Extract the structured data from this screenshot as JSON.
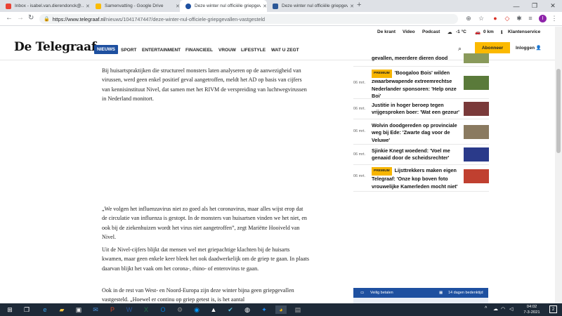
{
  "browser": {
    "tabs": [
      {
        "title": "Inbox - isabel.van.dierendonck@...",
        "icon": "gmail-icon",
        "color": "#ea4335"
      },
      {
        "title": "Samenvatting - Google Drive",
        "icon": "drive-icon",
        "color": "#fbbc04"
      },
      {
        "title": "Deze winter nul officiële griepgev...",
        "icon": "telegraaf-icon",
        "color": "#1e50a0"
      },
      {
        "title": "Deze winter nul officiële griepgev...",
        "icon": "dl-icon",
        "color": "#2b5797"
      }
    ],
    "url_host": "https://www.telegraaf.nl",
    "url_path": "/nieuws/1041747447/deze-winter-nul-officiele-griepgevallen-vastgesteld",
    "profile_initial": "I"
  },
  "site": {
    "logo": "De Telegraaf",
    "topbar": {
      "krant": "De krant",
      "video": "Video",
      "podcast": "Podcast",
      "temp": "-1 °C",
      "traffic": "0 km",
      "service": "Klantenservice"
    },
    "nav": [
      "NIEUWS",
      "SPORT",
      "ENTERTAINMENT",
      "FINANCIEEL",
      "VROUW",
      "LIFESTYLE",
      "WAT U ZEGT"
    ],
    "abonneer": "Abonneer",
    "login": "Inloggen"
  },
  "article": {
    "p1": "Bij huisartspraktijken die structureel monsters laten analyseren op de aanwezigheid van virussen, werd geen enkel positief geval aangetroffen, meldt het AD op basis van cijfers van kennisinstituut Nivel, dat samen met het RIVM de verspreiding van luchtwegvirussen in Nederland monitort.",
    "p2": "„We volgen het influenzavirus niet zo goed als het coronavirus, maar alles wijst erop dat de circulatie van influenza is gestopt. In de monsters van huisartsen vinden we het niet, en ook bij de ziekenhuizen wordt het virus niet aangetroffen”, zegt Mariëtte Hooiveld van Nivel.",
    "p3": "Uit de Nivel-cijfers blijkt dat mensen wel met griepachtige klachten bij de huisarts kwamen, maar geen enkele keer bleek het ook daadwerkelijk om de griep te gaan. In plaats daarvan blijkt het vaak om het corona-, rhino- of enterovirus te gaan.",
    "p4": "Ook in de rest van West- en Noord-Europa zijn deze winter bijna geen griepgevallen vastgesteld. „Hoewel er continu op griep getest is, is het aantal"
  },
  "sidebar": {
    "premium_label": "PREMIUM",
    "items": [
      {
        "date": "",
        "title": "gevallen, meerdere dieren dood",
        "premium": false,
        "thumb": "#8a9a5b"
      },
      {
        "date": "06 mrt.",
        "title": "'Boogaloo Bois' wilden zwaarbewapende extreemrechtse Nederlander sponsoren: 'Help onze Boi'",
        "premium": true,
        "thumb": "#5a7a3a"
      },
      {
        "date": "06 mrt.",
        "title": "Justitie in hoger beroep tegen vrijgesproken boer: 'Wat een gezeur'",
        "premium": false,
        "thumb": "#7a3a3a"
      },
      {
        "date": "06 mrt.",
        "title": "Wolvin doodgereden op provinciale weg bij Ede: 'Zwarte dag voor de Veluwe'",
        "premium": false,
        "thumb": "#8a7a60"
      },
      {
        "date": "06 mrt.",
        "title": "Sjinkie Knegt woedend: 'Voel me genaaid door de scheidsrechter'",
        "premium": false,
        "thumb": "#2a3a8a"
      },
      {
        "date": "06 mrt.",
        "title": "Lijsttrekkers maken eigen Telegraaf: 'Onze kop boven foto vrouwelijke Kamerleden mocht niet'",
        "premium": true,
        "thumb": "#c04030"
      }
    ],
    "sub_left": "Veilig betalen",
    "sub_right": "14 dagen bedenktijd"
  },
  "taskbar": {
    "time": "04:02",
    "date": "7-3-2021",
    "notifications": "2"
  }
}
